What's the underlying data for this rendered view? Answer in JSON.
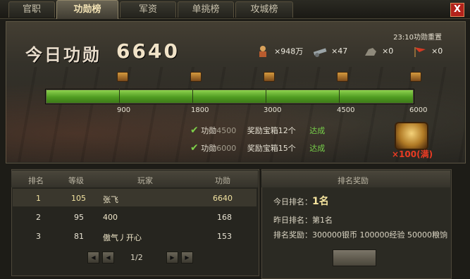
{
  "tabs": [
    "官职",
    "功勋榜",
    "军资",
    "单挑榜",
    "攻城榜"
  ],
  "active_tab": "功勋榜",
  "close_label": "X",
  "header": {
    "reset_text": "23:10功勋重置",
    "title": "今日功勋",
    "value": "6640"
  },
  "resources": [
    {
      "icon": "soldier-icon",
      "text": "×948万"
    },
    {
      "icon": "cannon-icon",
      "text": "×47"
    },
    {
      "icon": "cavalry-icon",
      "text": "×0"
    },
    {
      "icon": "flag-icon",
      "text": "×0"
    }
  ],
  "progress": {
    "value": 6640,
    "max": 6000,
    "fill_fraction": 1.0,
    "ticks": [
      "900",
      "1800",
      "3000",
      "4500",
      "6000"
    ]
  },
  "rewards": [
    {
      "prefix": "功勋",
      "amount": "4500",
      "reward": "奖励宝箱12个",
      "status": "达成"
    },
    {
      "prefix": "功勋",
      "amount": "6000",
      "reward": "奖励宝箱15个",
      "status": "达成"
    }
  ],
  "chest_count": "×100(满)",
  "table": {
    "headers": [
      "排名",
      "等级",
      "玩家",
      "功勋"
    ],
    "rows": [
      [
        "1",
        "105",
        "张飞",
        "6640"
      ],
      [
        "2",
        "95",
        "400",
        "168"
      ],
      [
        "3",
        "81",
        "傲气丿开心",
        "153"
      ]
    ],
    "page": "1/2"
  },
  "ranking": {
    "title": "排名奖励",
    "today_label": "今日排名：",
    "today_value": "1名",
    "yesterday_label": "昨日排名：",
    "yesterday_value": "第1名",
    "reward_label": "排名奖励：",
    "reward_value": "300000银币 100000经验 50000粮饷"
  }
}
